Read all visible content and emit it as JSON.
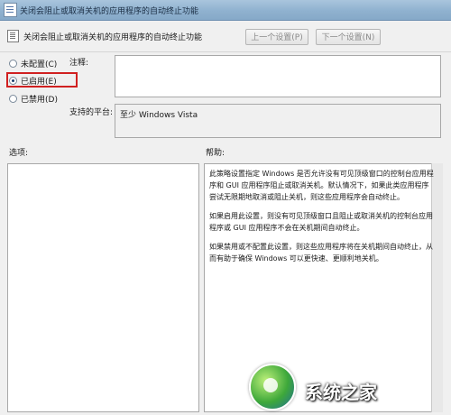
{
  "window": {
    "title": "关闭会阻止或取消关机的应用程序的自动终止功能"
  },
  "header": {
    "policy_title": "关闭会阻止或取消关机的应用程序的自动终止功能",
    "prev_label": "上一个设置(P)",
    "next_label": "下一个设置(N)"
  },
  "options": {
    "not_configured": "未配置(C)",
    "enabled": "已启用(E)",
    "disabled": "已禁用(D)",
    "selected": "enabled"
  },
  "comment_label": "注释:",
  "platform": {
    "label": "支持的平台:",
    "value": "至少 Windows Vista"
  },
  "sections": {
    "options_label": "选项:",
    "help_label": "帮助:"
  },
  "help": {
    "p1": "此策略设置指定 Windows 是否允许没有可见顶级窗口的控制台应用程序和 GUI 应用程序阻止或取消关机。默认情况下，如果此类应用程序尝试无限期地取消或阻止关机，则这些应用程序会自动终止。",
    "p2": "如果启用此设置，则没有可见顶级窗口且阻止或取消关机的控制台应用程序或 GUI 应用程序不会在关机期间自动终止。",
    "p3": "如果禁用或不配置此设置，则这些应用程序将在关机期间自动终止，从而有助于确保 Windows 可以更快速、更顺利地关机。"
  },
  "watermark": {
    "text": "系统之家"
  },
  "colors": {
    "highlight": "#d02020",
    "titlebar": "#9dbbd6"
  }
}
